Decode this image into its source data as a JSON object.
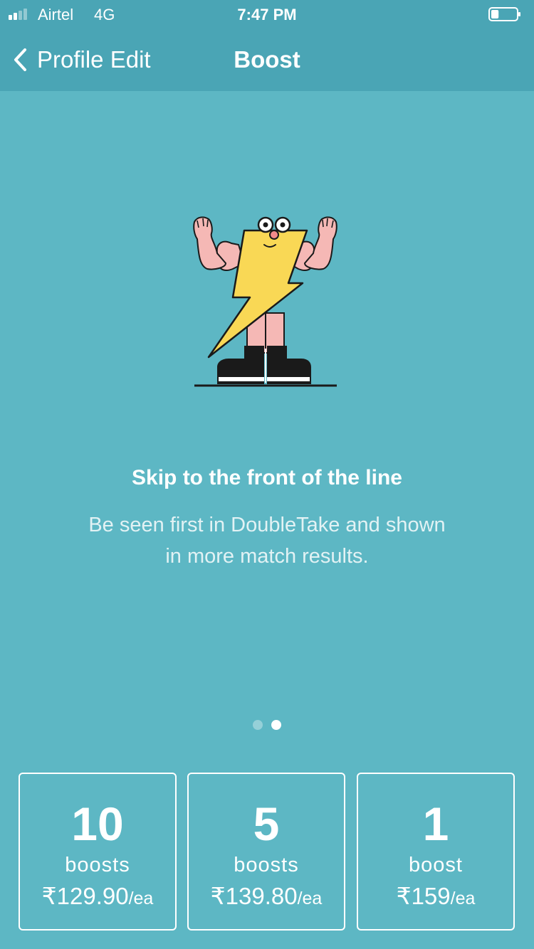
{
  "status_bar": {
    "carrier": "Airtel",
    "network": "4G",
    "time": "7:47 PM",
    "signal_icon": "signal-bars-icon",
    "battery_icon": "battery-icon",
    "battery_level": 0.3
  },
  "nav": {
    "back_label": "Profile Edit",
    "title": "Boost",
    "back_icon": "chevron-left-icon"
  },
  "illustration": {
    "name": "flexing-lightning-bolt-illustration",
    "colors": {
      "bolt": "#f9d855",
      "skin": "#f5b8b5",
      "outline": "#1a1a1a",
      "shoe": "#1a1a1a"
    }
  },
  "content": {
    "headline": "Skip to the front of the line",
    "subtext": "Be seen first in DoubleTake and shown in more match results."
  },
  "pager": {
    "pages": 2,
    "active_index": 1
  },
  "options": [
    {
      "count": "10",
      "unit": "boosts",
      "price": "₹129.90",
      "per": "/ea"
    },
    {
      "count": "5",
      "unit": "boosts",
      "price": "₹139.80",
      "per": "/ea"
    },
    {
      "count": "1",
      "unit": "boost",
      "price": "₹159",
      "per": "/ea"
    }
  ],
  "colors": {
    "background": "#5db7c4",
    "bar": "#4aa5b5",
    "text": "#ffffff"
  }
}
